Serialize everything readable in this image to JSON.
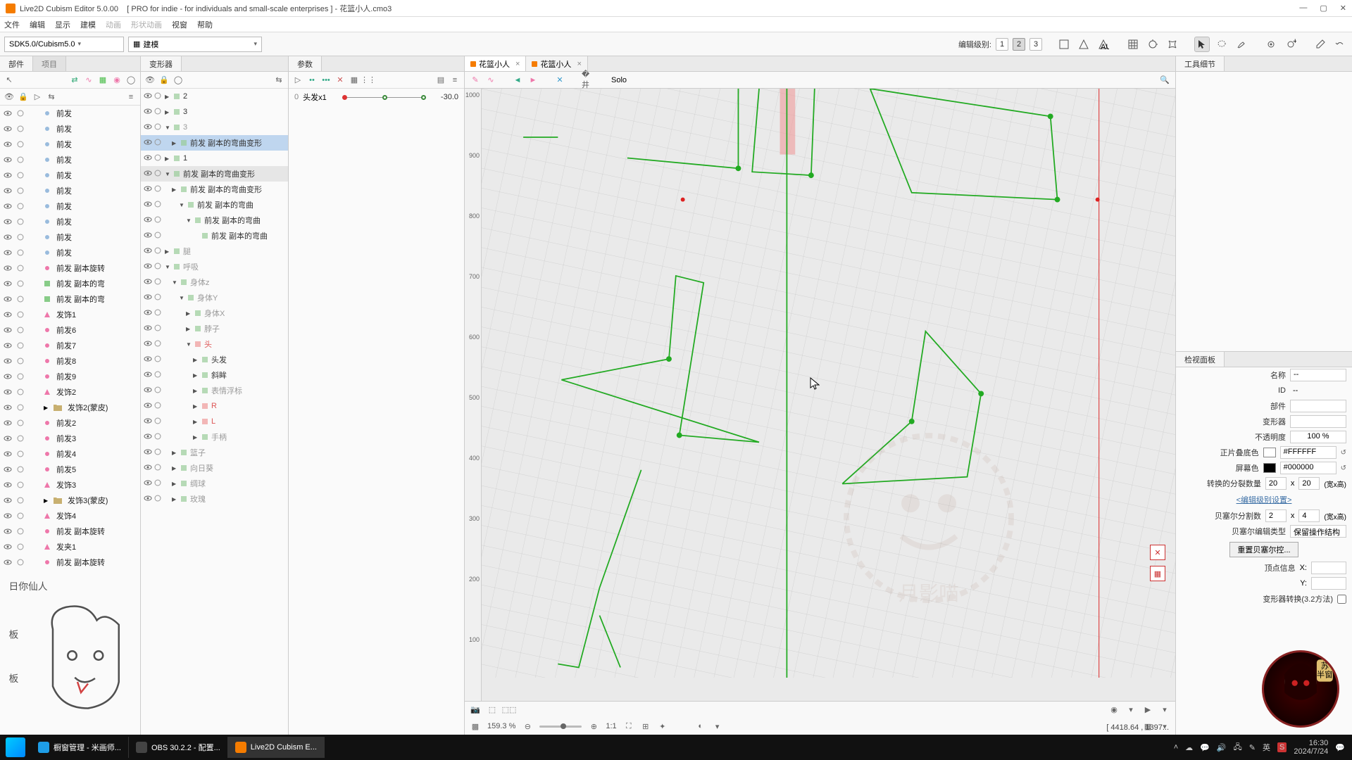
{
  "title": {
    "app": "Live2D Cubism Editor 5.0.00",
    "license": "[ PRO for indie - for individuals and small-scale enterprises ]",
    "file": " - 花篮小人.cmo3"
  },
  "menu": {
    "items": [
      "文件",
      "编辑",
      "显示",
      "建模",
      "动画",
      "形状动画",
      "视窗",
      "帮助"
    ],
    "disabled": [
      4,
      5
    ]
  },
  "toolbar": {
    "sdk_combo": "SDK5.0/Cubism5.0",
    "mode_combo": "建模",
    "edit_level_label": "编辑级别:",
    "levels": [
      "1",
      "2",
      "3"
    ],
    "active_level": 1
  },
  "parts_panel": {
    "tabs": [
      "部件",
      "项目"
    ],
    "rows": [
      {
        "name": "前发",
        "type": "mesh"
      },
      {
        "name": "前发",
        "type": "mesh"
      },
      {
        "name": "前发",
        "type": "mesh"
      },
      {
        "name": "前发",
        "type": "mesh"
      },
      {
        "name": "前发",
        "type": "mesh"
      },
      {
        "name": "前发",
        "type": "mesh"
      },
      {
        "name": "前发",
        "type": "mesh"
      },
      {
        "name": "前发",
        "type": "mesh"
      },
      {
        "name": "前发",
        "type": "mesh"
      },
      {
        "name": "前发",
        "type": "mesh"
      },
      {
        "name": "前发 副本旋转",
        "type": "rot"
      },
      {
        "name": "前发 副本的弯",
        "type": "warp"
      },
      {
        "name": "前发 副本的弯",
        "type": "warp"
      },
      {
        "name": "发饰1",
        "type": "art"
      },
      {
        "name": "前发6",
        "type": "rot"
      },
      {
        "name": "前发7",
        "type": "rot"
      },
      {
        "name": "前发8",
        "type": "rot"
      },
      {
        "name": "前发9",
        "type": "rot"
      },
      {
        "name": "发饰2",
        "type": "art"
      },
      {
        "name": "发饰2(蒙皮)",
        "type": "folder",
        "exp": true
      },
      {
        "name": "前发2",
        "type": "rot"
      },
      {
        "name": "前发3",
        "type": "rot"
      },
      {
        "name": "前发4",
        "type": "rot"
      },
      {
        "name": "前发5",
        "type": "rot"
      },
      {
        "name": "发饰3",
        "type": "art"
      },
      {
        "name": "发饰3(蒙皮)",
        "type": "folder",
        "exp": true
      },
      {
        "name": "发饰4",
        "type": "art"
      },
      {
        "name": "前发 副本旋转",
        "type": "rot"
      },
      {
        "name": "发夹1",
        "type": "art"
      },
      {
        "name": "前发 副本旋转",
        "type": "rot"
      }
    ]
  },
  "deformer_panel": {
    "tab": "变形器",
    "rows": [
      {
        "ind": 0,
        "tri": "▶",
        "txt": "2"
      },
      {
        "ind": 0,
        "tri": "▶",
        "txt": "3"
      },
      {
        "ind": 0,
        "tri": "▼",
        "txt": "3",
        "gray": true
      },
      {
        "ind": 1,
        "tri": "▶",
        "txt": "前发 副本的弯曲变形",
        "sel": true
      },
      {
        "ind": 0,
        "tri": "▶",
        "txt": "1"
      },
      {
        "ind": 0,
        "tri": "▼",
        "txt": "前发 副本的弯曲变形",
        "sub": true
      },
      {
        "ind": 1,
        "tri": "▶",
        "txt": "前发 副本的弯曲变形"
      },
      {
        "ind": 2,
        "tri": "▼",
        "txt": "前发 副本的弯曲"
      },
      {
        "ind": 3,
        "tri": "▼",
        "txt": "前发 副本的弯曲"
      },
      {
        "ind": 4,
        "tri": "",
        "txt": "前发 副本的弯曲"
      },
      {
        "ind": 0,
        "tri": "▶",
        "txt": "腿",
        "gray": true
      },
      {
        "ind": 0,
        "tri": "▼",
        "txt": "呼吸",
        "gray": true
      },
      {
        "ind": 1,
        "tri": "▼",
        "txt": "身体z",
        "gray": true
      },
      {
        "ind": 2,
        "tri": "▼",
        "txt": "身体Y",
        "gray": true
      },
      {
        "ind": 3,
        "tri": "▶",
        "txt": "身体X",
        "gray": true
      },
      {
        "ind": 3,
        "tri": "▶",
        "txt": "脖子",
        "gray": true
      },
      {
        "ind": 3,
        "tri": "▼",
        "txt": "头",
        "red": true
      },
      {
        "ind": 4,
        "tri": "▶",
        "txt": "头发"
      },
      {
        "ind": 4,
        "tri": "▶",
        "txt": "斜眸"
      },
      {
        "ind": 4,
        "tri": "▶",
        "txt": "表情浮标",
        "gray": true
      },
      {
        "ind": 4,
        "tri": "▶",
        "txt": "R",
        "red": true
      },
      {
        "ind": 4,
        "tri": "▶",
        "txt": "L",
        "red": true
      },
      {
        "ind": 4,
        "tri": "▶",
        "txt": "手柄",
        "gray": true
      },
      {
        "ind": 1,
        "tri": "▶",
        "txt": "篮子",
        "gray": true
      },
      {
        "ind": 1,
        "tri": "▶",
        "txt": "向日葵",
        "gray": true
      },
      {
        "ind": 1,
        "tri": "▶",
        "txt": "绸球",
        "gray": true
      },
      {
        "ind": 1,
        "tri": "▶",
        "txt": "玫瑰",
        "gray": true
      }
    ]
  },
  "params_panel": {
    "tab": "参数",
    "row": {
      "name": "头发x1",
      "value": "-30.0",
      "index": "0"
    }
  },
  "canvas": {
    "tabs": [
      {
        "label": "花篮小人"
      },
      {
        "label": "花篮小人"
      }
    ],
    "solo_label": "Solo",
    "ruler_ticks": [
      "1000",
      "900",
      "800",
      "700",
      "600",
      "500",
      "400",
      "300",
      "200",
      "100"
    ],
    "zoom": "159.3 %",
    "ratio": "1:1",
    "coords": "[ 4418.64 , 1397..."
  },
  "tool_detail": {
    "tab": "工具细节"
  },
  "inspector": {
    "tab": "检视面板",
    "rows": {
      "name_lbl": "名称",
      "name_val": "--",
      "id_lbl": "ID",
      "id_val": "--",
      "part_lbl": "部件",
      "part_val": "",
      "def_lbl": "变形器",
      "def_val": "",
      "opacity_lbl": "不透明度",
      "opacity_val": "100 %",
      "multcol_lbl": "正片叠底色",
      "multcol_val": "#FFFFFF",
      "screen_lbl": "屏幕色",
      "screen_val": "#000000",
      "div_lbl": "转换的分裂数量",
      "div_x": "20",
      "div_y": "20",
      "div_suffix": "(宽x高)",
      "editlvl_link": "<编辑级别设置>",
      "bez_lbl": "贝塞尔分割数",
      "bez_x": "2",
      "bez_y": "4",
      "bez_suffix": "(宽x高)",
      "beztype_lbl": "贝塞尔编辑类型",
      "beztype_val": "保留操作结构",
      "reset_btn": "重置贝塞尔控...",
      "vtx_lbl": "顶点信息",
      "vtx_x": "X:",
      "vtx_y": "Y:",
      "conv_lbl": "变形器转换(3.2方法)"
    }
  },
  "taskbar": {
    "tasks": [
      {
        "label": "橱窗管理 - 米画师...",
        "color": "#1e9de6"
      },
      {
        "label": "OBS 30.2.2 - 配置...",
        "color": "#444"
      },
      {
        "label": "Live2D Cubism E...",
        "color": "#f57c00"
      }
    ],
    "active": 2,
    "ime": "英",
    "time": "16:30",
    "date": "2024/7/24"
  }
}
